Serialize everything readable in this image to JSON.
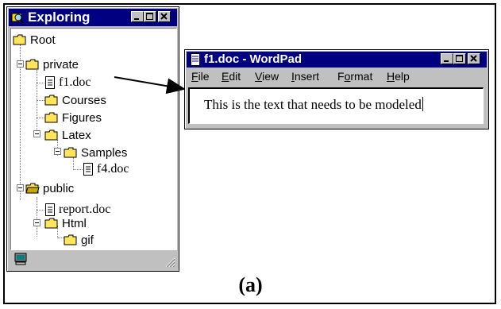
{
  "explorer": {
    "title": "Exploring",
    "tree": [
      {
        "id": "root",
        "label": "Root"
      },
      {
        "id": "private",
        "label": "private"
      },
      {
        "id": "f1doc",
        "label": "f1.doc"
      },
      {
        "id": "courses",
        "label": "Courses"
      },
      {
        "id": "figures",
        "label": "Figures"
      },
      {
        "id": "latex",
        "label": "Latex"
      },
      {
        "id": "samples",
        "label": "Samples"
      },
      {
        "id": "f4doc",
        "label": "f4.doc"
      },
      {
        "id": "public",
        "label": "public"
      },
      {
        "id": "reportdoc",
        "label": "report.doc"
      },
      {
        "id": "html",
        "label": "Html"
      },
      {
        "id": "gif",
        "label": "gif"
      }
    ]
  },
  "wordpad": {
    "title": "f1.doc - WordPad",
    "menu": [
      {
        "label": "File",
        "key": "F",
        "rest": "ile"
      },
      {
        "label": "Edit",
        "key": "E",
        "rest": "dit"
      },
      {
        "label": "View",
        "key": "V",
        "rest": "iew"
      },
      {
        "label": "Insert",
        "key": "I",
        "rest": "nsert"
      },
      {
        "label": "Format",
        "pre": "F",
        "key": "o",
        "rest": "rmat"
      },
      {
        "label": "Help",
        "key": "H",
        "rest": "elp"
      }
    ],
    "document_text": "This is the text that needs to be modeled"
  },
  "caption": "(a)",
  "icons": {
    "app": "explorer-icon",
    "folder": "folder-icon",
    "document": "document-icon",
    "computer": "computer-icon"
  }
}
